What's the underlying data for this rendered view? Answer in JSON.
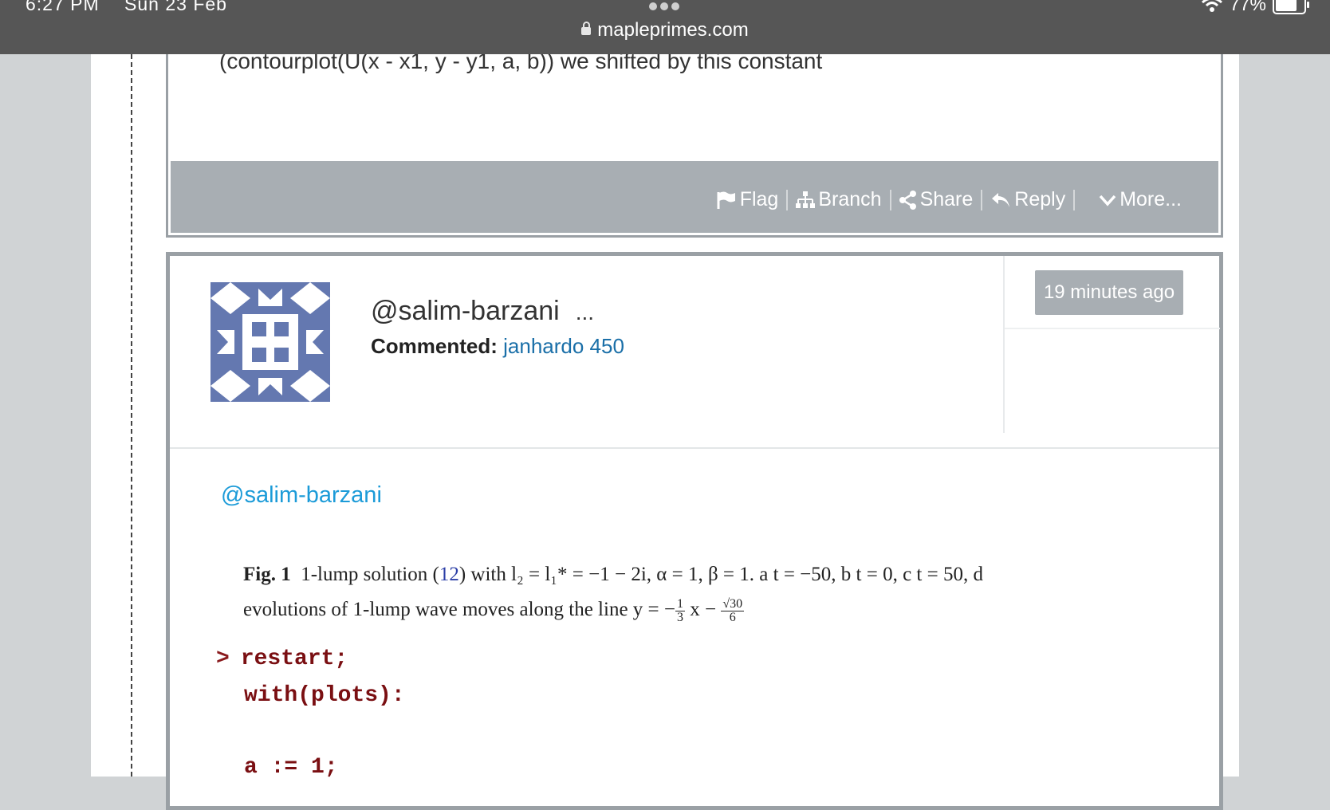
{
  "status_bar": {
    "time": "6:27 PM",
    "date": "Sun 23 Feb",
    "battery": "77%",
    "battery_level": 0.77
  },
  "browser": {
    "url": "mapleprimes.com"
  },
  "previous_post": {
    "text": "(contourplot(U(x - x1, y - y1, a, b)) we shifted by this constant",
    "actions": {
      "flag": "Flag",
      "branch": "Branch",
      "share": "Share",
      "reply": "Reply",
      "more": "More..."
    }
  },
  "comment": {
    "username": "@salim-barzani",
    "ellipsis": "...",
    "commented_label": "Commented:",
    "commented_on": "janhardo 450",
    "time_ago": "19 minutes ago",
    "mention": "@salim-barzani",
    "figure_caption": {
      "label": "Fig. 1",
      "text_a": "1-lump solution (",
      "ref": "12",
      "text_b": ") with l₂ = l₁* = −1 − 2i, α = 1, β = 1. a t = −50, b t = 0, c t = 50, d",
      "line2": "evolutions of 1-lump wave moves along the line y = −",
      "frac1_num": "1",
      "frac1_den": "3",
      "line2_mid": "x −",
      "frac2_num": "√30",
      "frac2_den": "6"
    },
    "code": {
      "prompt": ">",
      "line1": "restart;",
      "line2": "with(plots):",
      "line3": "a := 1;"
    }
  },
  "colors": {
    "chrome": "#565656",
    "action_bar": "#a8aeb3",
    "link": "#1a6fa8",
    "mention": "#1c9bd8",
    "maple_code": "#7a0f12"
  }
}
